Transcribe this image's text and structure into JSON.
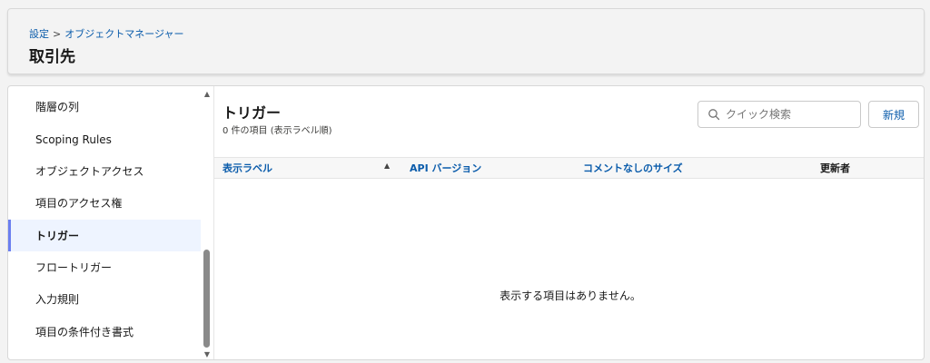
{
  "header": {
    "breadcrumb": {
      "settings": "設定",
      "separator": ">",
      "object_manager": "オブジェクトマネージャー"
    },
    "title": "取引先"
  },
  "sidebar": {
    "items": [
      {
        "label": "階層の列",
        "active": false
      },
      {
        "label": "Scoping Rules",
        "active": false
      },
      {
        "label": "オブジェクトアクセス",
        "active": false
      },
      {
        "label": "項目のアクセス権",
        "active": false
      },
      {
        "label": "トリガー",
        "active": true
      },
      {
        "label": "フロートリガー",
        "active": false
      },
      {
        "label": "入力規則",
        "active": false
      },
      {
        "label": "項目の条件付き書式",
        "active": false
      }
    ]
  },
  "main": {
    "title": "トリガー",
    "count_text": "0 件の項目 (表示ラベル順)",
    "search": {
      "placeholder": "クイック検索",
      "value": ""
    },
    "new_button": "新規",
    "columns": [
      {
        "label": "表示ラベル",
        "sorted": true
      },
      {
        "label": "API バージョン",
        "sorted": false
      },
      {
        "label": "コメントなしのサイズ",
        "sorted": false
      },
      {
        "label": "更新者",
        "sorted": false
      }
    ],
    "empty_message": "表示する項目はありません。"
  },
  "colors": {
    "link": "#0b5cab",
    "active_indicator": "#6b7ff0",
    "active_bg": "#eef4ff"
  },
  "icons": {
    "search": "search-icon",
    "sort": "sort-ascending-icon",
    "scroll_up": "chevron-up-icon",
    "scroll_down": "chevron-down-icon"
  }
}
